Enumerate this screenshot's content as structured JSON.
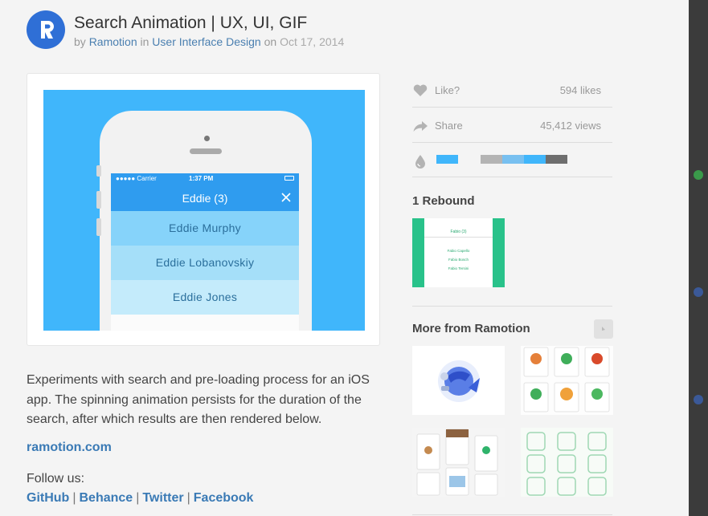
{
  "header": {
    "title": "Search Animation | UX, UI, GIF",
    "by_word": "by",
    "author": "Ramotion",
    "in_word": "in",
    "team": "User Interface Design",
    "on_word": "on",
    "date": "Oct 17, 2014"
  },
  "shot": {
    "status_carrier": "●●●●● Carrier",
    "status_time": "1:37 PM",
    "nav_title": "Eddie (3)",
    "results": [
      "Eddie Murphy",
      "Eddie Lobanovskiy",
      "Eddie Jones"
    ]
  },
  "description": {
    "text": "Experiments with search and pre-loading process for an iOS app. The spinning animation persists for the duration of the search, after which results are then rendered below.",
    "site": "ramotion.com",
    "follow_label": "Follow us:",
    "social": [
      "GitHub",
      "Behance",
      "Twitter",
      "Facebook"
    ]
  },
  "sidebar": {
    "like_label": "Like?",
    "likes": "594 likes",
    "share_label": "Share",
    "views": "45,412 views",
    "palette": [
      "#40b6fb",
      "#f4f4f4",
      "#b4b4b4",
      "#78c0f0",
      "#40b6fb",
      "#6e6e6e"
    ],
    "rebound_title": "1 Rebound",
    "rebound_thumb": {
      "head": "Fabio (3)",
      "rows": [
        "Fabio Capello",
        "Fabio Bosch",
        "Fabio Tersini"
      ]
    },
    "more_title": "More from Ramotion"
  },
  "colors": {
    "accent_link": "#3a7ab5",
    "shot_bg": "#40b6fb",
    "rebound_green": "#29c28a"
  }
}
